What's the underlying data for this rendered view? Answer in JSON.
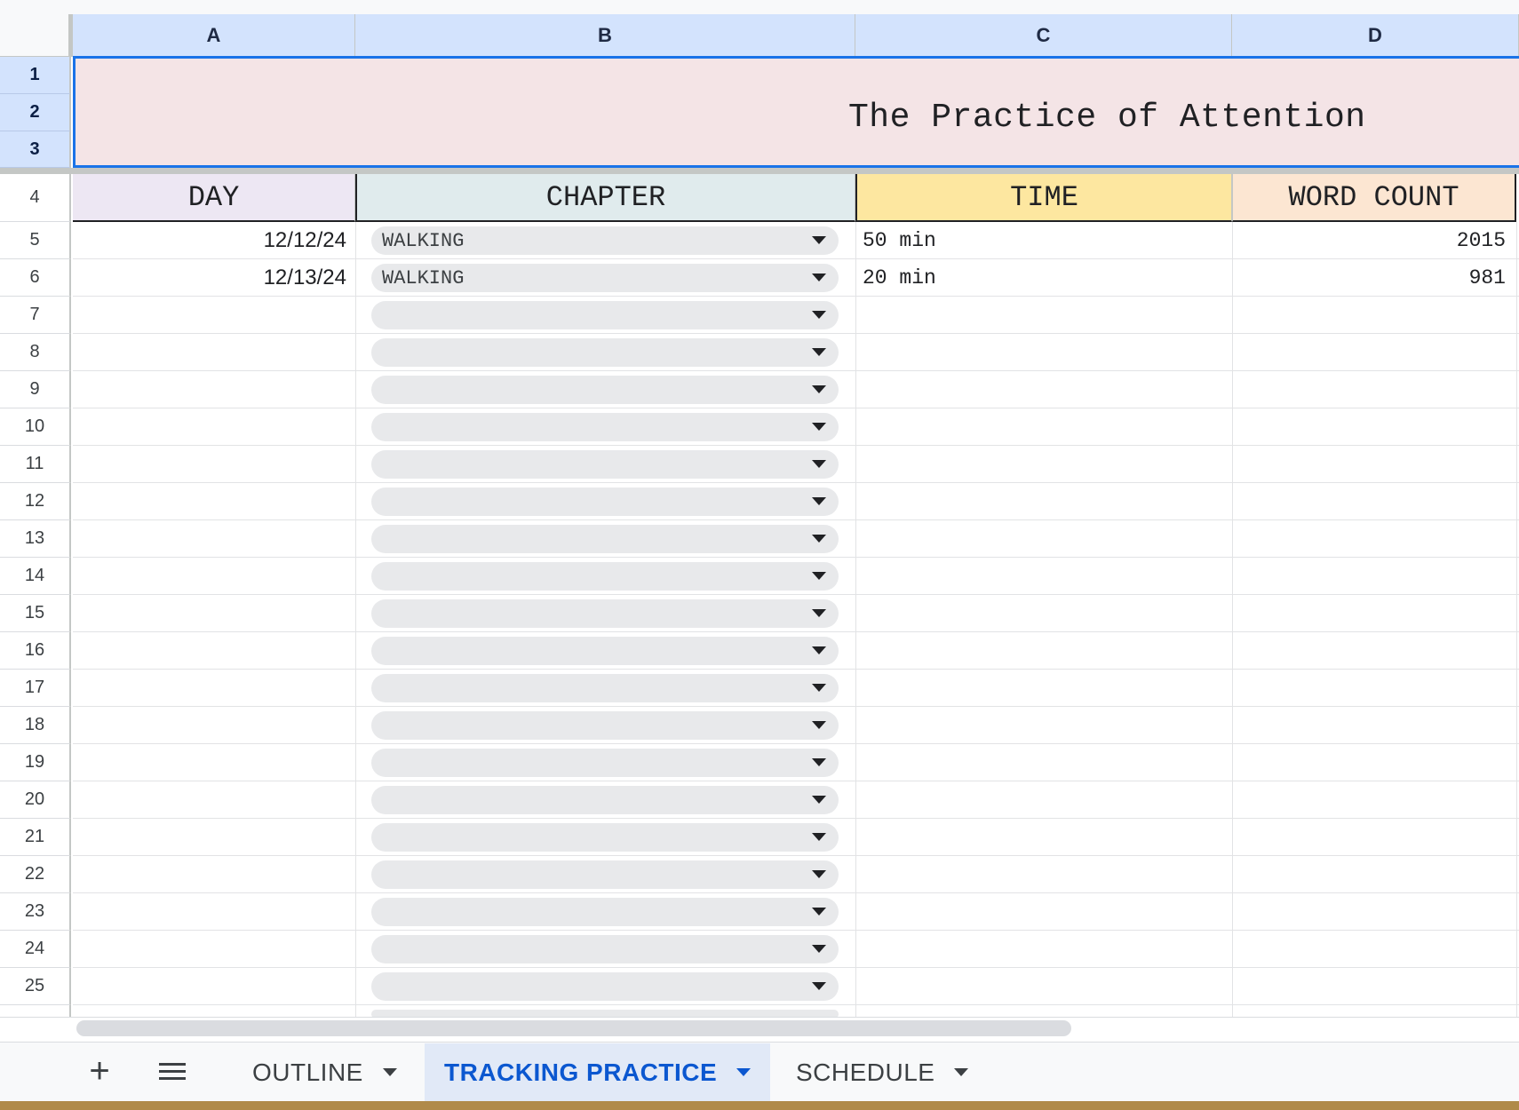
{
  "columns": [
    "A",
    "B",
    "C",
    "D"
  ],
  "row_numbers": [
    "1",
    "2",
    "3",
    "4",
    "5",
    "6",
    "7",
    "8",
    "9",
    "10",
    "11",
    "12",
    "13",
    "14",
    "15",
    "16",
    "17",
    "18",
    "19",
    "20",
    "21",
    "22",
    "23",
    "24",
    "25"
  ],
  "title": "The Practice of Attention",
  "headers": {
    "day": "DAY",
    "chapter": "CHAPTER",
    "time": "TIME",
    "word_count": "WORD COUNT"
  },
  "rows": [
    {
      "day": "12/12/24",
      "chapter": "WALKING",
      "time": "50 min",
      "word_count": "2015"
    },
    {
      "day": "12/13/24",
      "chapter": "WALKING",
      "time": "20 min",
      "word_count": "981"
    }
  ],
  "empty_dropdown_rows": 19,
  "sheet_tabs": {
    "add_icon": "plus-icon",
    "all_sheets_icon": "menu-icon",
    "tabs": [
      {
        "label": "OUTLINE",
        "active": false
      },
      {
        "label": "TRACKING PRACTICE",
        "active": true
      },
      {
        "label": "SCHEDULE",
        "active": false
      }
    ]
  },
  "colors": {
    "title_bg": "#f4e4e6",
    "selection": "#1a73e8",
    "day_header": "#ede7f3",
    "chapter_header": "#e0ebed",
    "time_header": "#fde7a0",
    "word_count_header": "#fce6d2",
    "active_tab": "#0b57d0"
  }
}
